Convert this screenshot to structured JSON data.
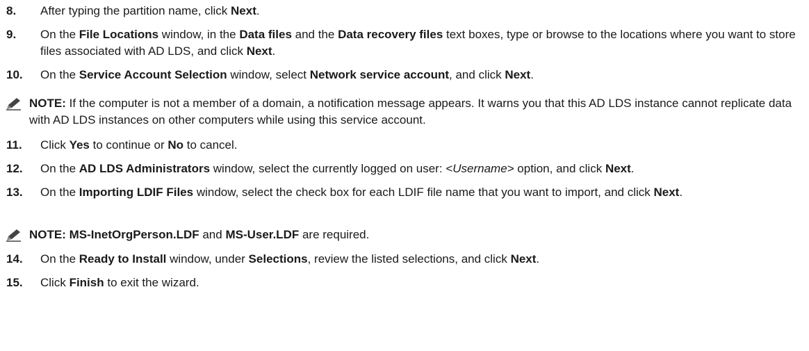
{
  "steps": [
    {
      "number": "8.",
      "segments": [
        {
          "t": "After typing the partition name, click "
        },
        {
          "t": "Next",
          "b": true
        },
        {
          "t": "."
        }
      ]
    },
    {
      "number": "9.",
      "segments": [
        {
          "t": "On the "
        },
        {
          "t": "File Locations",
          "b": true
        },
        {
          "t": " window, in the "
        },
        {
          "t": "Data files",
          "b": true
        },
        {
          "t": " and the "
        },
        {
          "t": "Data recovery files",
          "b": true
        },
        {
          "t": " text boxes, type or browse to the locations where you want to store files associated with AD LDS, and click "
        },
        {
          "t": "Next",
          "b": true
        },
        {
          "t": "."
        }
      ]
    },
    {
      "number": "10.",
      "segments": [
        {
          "t": "On the "
        },
        {
          "t": "Service Account Selection",
          "b": true
        },
        {
          "t": " window, select "
        },
        {
          "t": "Network service account",
          "b": true
        },
        {
          "t": ", and click "
        },
        {
          "t": "Next",
          "b": true
        },
        {
          "t": "."
        }
      ]
    },
    {
      "number": "11.",
      "segments": [
        {
          "t": "Click "
        },
        {
          "t": "Yes",
          "b": true
        },
        {
          "t": " to continue or "
        },
        {
          "t": "No",
          "b": true
        },
        {
          "t": " to cancel."
        }
      ]
    },
    {
      "number": "12.",
      "segments": [
        {
          "t": "On the "
        },
        {
          "t": "AD LDS Administrators",
          "b": true
        },
        {
          "t": " window, select the currently logged on user: "
        },
        {
          "t": "<Username>",
          "i": true
        },
        {
          "t": " option, and click "
        },
        {
          "t": "Next",
          "b": true
        },
        {
          "t": "."
        }
      ]
    },
    {
      "number": "13.",
      "segments": [
        {
          "t": "On the "
        },
        {
          "t": "Importing LDIF Files",
          "b": true
        },
        {
          "t": " window, select the check box for each LDIF file name that you want to import, and click "
        },
        {
          "t": "Next",
          "b": true
        },
        {
          "t": "."
        }
      ]
    },
    {
      "number": "14.",
      "segments": [
        {
          "t": "On the "
        },
        {
          "t": "Ready to Install",
          "b": true
        },
        {
          "t": " window, under "
        },
        {
          "t": "Selections",
          "b": true
        },
        {
          "t": ", review the listed selections, and click "
        },
        {
          "t": "Next",
          "b": true
        },
        {
          "t": "."
        }
      ]
    },
    {
      "number": "15.",
      "segments": [
        {
          "t": "Click "
        },
        {
          "t": "Finish",
          "b": true
        },
        {
          "t": " to exit the wizard."
        }
      ]
    }
  ],
  "notes": [
    {
      "icon": "pencil-note-icon",
      "segments": [
        {
          "t": "NOTE:",
          "b": true
        },
        {
          "t": " If the computer is not a member of a domain, a notification message appears. It warns you that this AD LDS instance cannot replicate data with AD LDS instances on other computers while using this service account."
        }
      ]
    },
    {
      "icon": "pencil-note-icon",
      "segments": [
        {
          "t": "NOTE: MS-InetOrgPerson.LDF",
          "b": true
        },
        {
          "t": " and "
        },
        {
          "t": "MS-User.LDF",
          "b": true
        },
        {
          "t": " are required."
        }
      ]
    }
  ]
}
